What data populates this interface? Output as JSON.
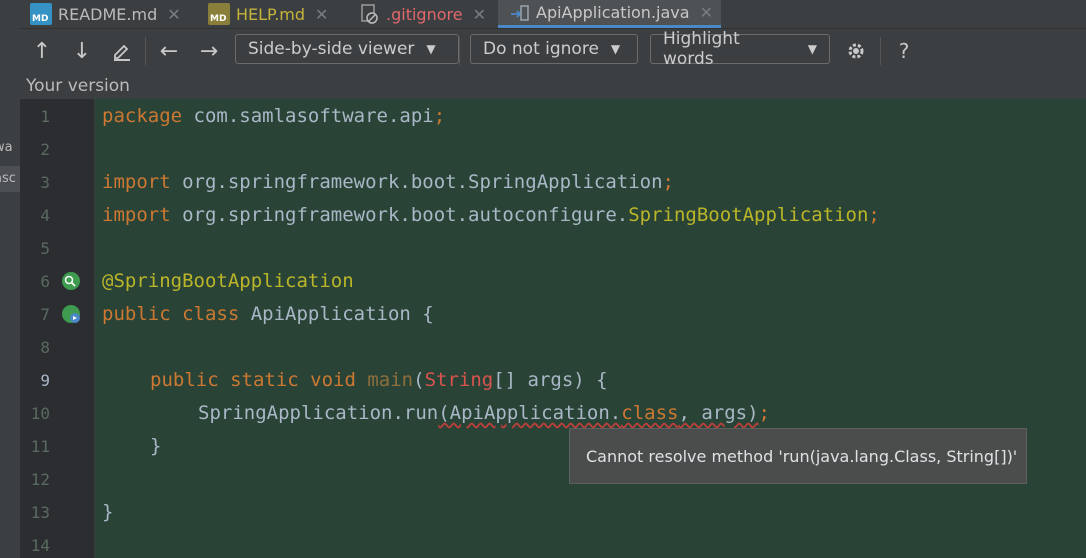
{
  "tabs": [
    {
      "label": "README.md",
      "icon": "markdown-file-icon",
      "color": "#bbbbbb",
      "active": false
    },
    {
      "label": "HELP.md",
      "icon": "markdown-file-icon",
      "color": "#c5b33a",
      "active": false
    },
    {
      "label": ".gitignore",
      "icon": "ignore-file-icon",
      "color": "#e0676b",
      "active": false
    },
    {
      "label": "ApiApplication.java",
      "icon": "diff-file-icon",
      "color": "#c8c8c8",
      "active": true
    }
  ],
  "left_fragments": [
    "wa",
    "asc"
  ],
  "toolbar": {
    "viewer": "Side-by-side viewer",
    "ignore": "Do not ignore",
    "highlight": "Highlight words",
    "help": "?"
  },
  "panel_title": "Your version",
  "line_numbers": [
    "1",
    "2",
    "3",
    "4",
    "5",
    "6",
    "7",
    "8",
    "9",
    "10",
    "11",
    "12",
    "13",
    "14"
  ],
  "code": {
    "l1_kw": "package",
    "l1_rest": " com.samlasoftware.api",
    "l1_semi": ";",
    "l3_kw": "import",
    "l3_rest": " org.springframework.boot.SpringApplication",
    "l3_semi": ";",
    "l4_kw": "import",
    "l4_rest": " org.springframework.boot.autoconfigure.",
    "l4_cls": "SpringBootApplication",
    "l4_semi": ";",
    "l6_ann": "@SpringBootApplication",
    "l7_kw": "public class",
    "l7_rest": " ApiApplication {",
    "l9_kw": "public static void",
    "l9_fn": " main",
    "l9_p1": "(",
    "l9_ty": "String",
    "l9_p2": "[] args) {",
    "l10_a": "SpringApplication.run",
    "l10_b": "(ApiApplication.",
    "l10_c": "class",
    "l10_d": ", args)",
    "l10_e": ";",
    "l11": "}",
    "l13": "}"
  },
  "tooltip": "Cannot resolve method 'run(java.lang.Class, String[])'",
  "colors": {
    "editor_bg": "#294436",
    "keyword": "#cc7832",
    "annotation": "#bbb529",
    "error": "#bc3f3c"
  }
}
